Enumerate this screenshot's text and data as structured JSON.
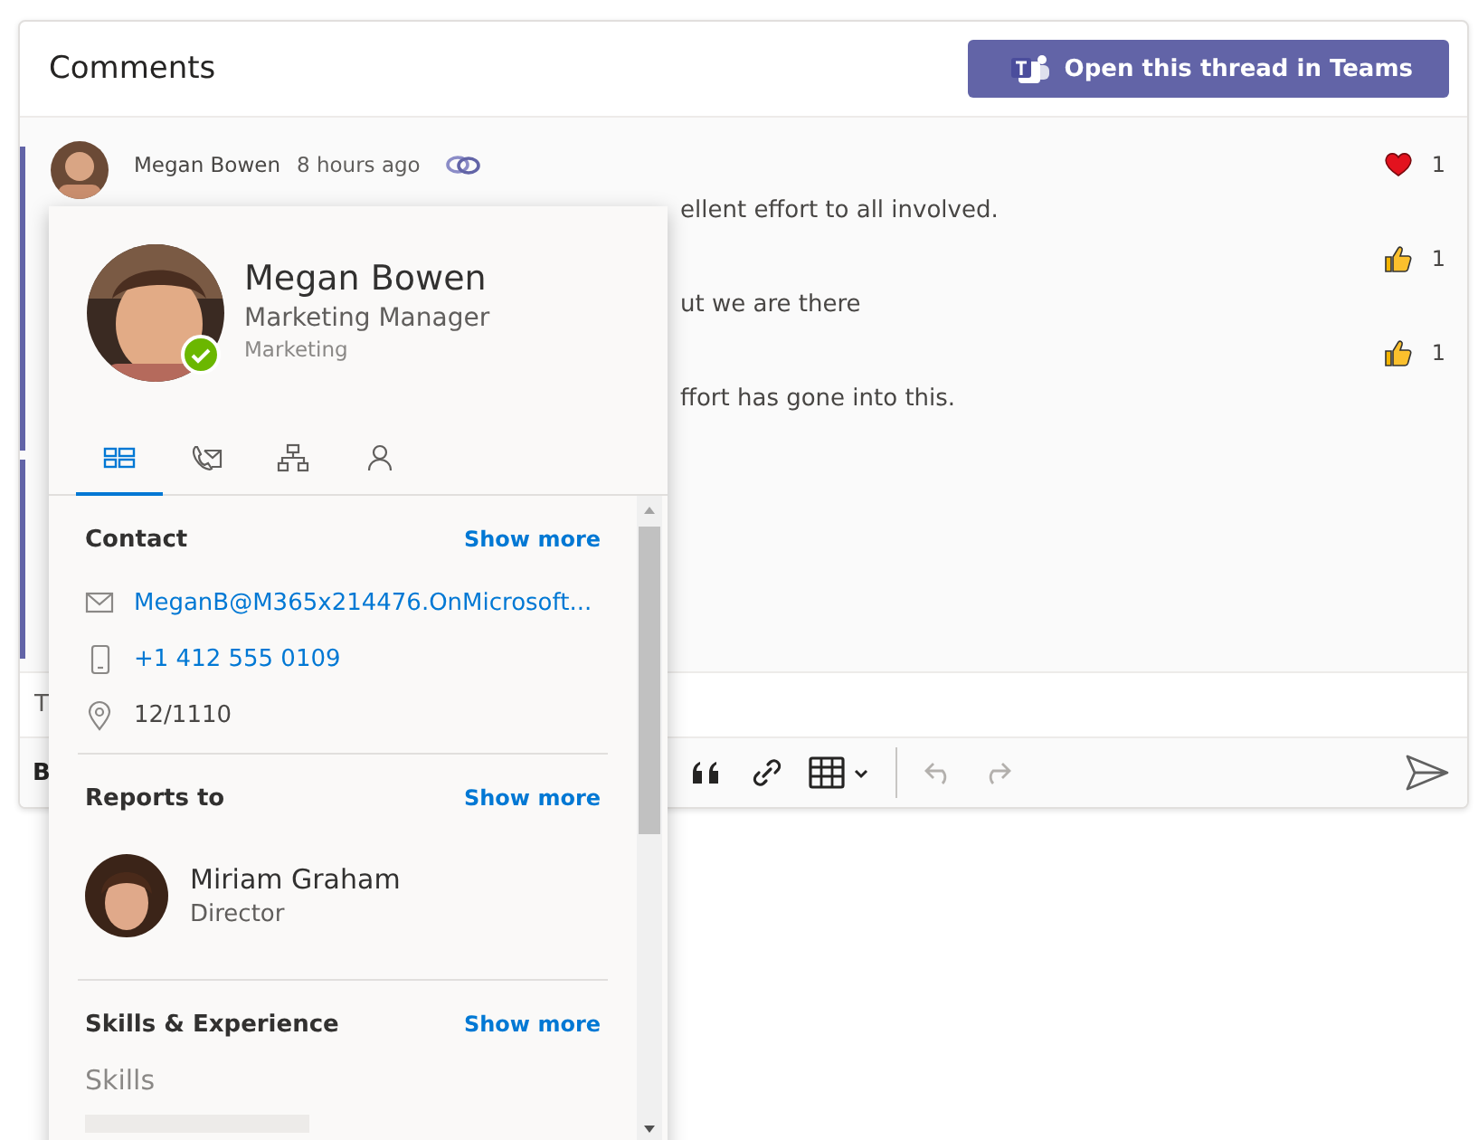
{
  "header": {
    "title": "Comments",
    "teams_button": "Open this thread in Teams"
  },
  "comment": {
    "author": "Megan Bowen",
    "time": "8 hours ago"
  },
  "messages": [
    {
      "text": "ellent effort to all involved.",
      "reaction": {
        "kind": "heart",
        "count": "1"
      }
    },
    {
      "text": "ut we are there",
      "reaction": {
        "kind": "thumbs",
        "count": "1"
      }
    },
    {
      "text": "ffort has gone into this.",
      "reaction": {
        "kind": "thumbs",
        "count": "1"
      }
    }
  ],
  "composer": {
    "placeholder": "T"
  },
  "toolbar": [
    {
      "kind": "bold",
      "label": "B",
      "disabled": false
    },
    {
      "kind": "quote",
      "disabled": false
    },
    {
      "kind": "link",
      "disabled": false
    },
    {
      "kind": "table",
      "disabled": false
    },
    {
      "kind": "undo",
      "disabled": true
    },
    {
      "kind": "redo",
      "disabled": true
    },
    {
      "kind": "send",
      "disabled": false
    }
  ],
  "profile_card": {
    "name": "Megan Bowen",
    "job_title": "Marketing Manager",
    "department": "Marketing",
    "online": true,
    "tabs": [
      {
        "kind": "overview",
        "selected": true
      },
      {
        "kind": "contact",
        "selected": false
      },
      {
        "kind": "organization",
        "selected": false
      },
      {
        "kind": "person",
        "selected": false
      }
    ],
    "sections": [
      {
        "kind": "contact",
        "title": "Contact",
        "show_more": "Show more",
        "items": [
          {
            "kind": "email",
            "text": "MeganB@M365x214476.OnMicrosoft..."
          },
          {
            "kind": "phone",
            "text": "+1 412 555 0109"
          },
          {
            "kind": "location",
            "text": "12/1110"
          }
        ]
      },
      {
        "kind": "reports",
        "title": "Reports to",
        "show_more": "Show more",
        "person": {
          "name": "Miriam Graham",
          "title": "Director"
        }
      },
      {
        "kind": "skills",
        "title": "Skills & Experience",
        "show_more": "Show more",
        "subheading": "Skills"
      }
    ]
  }
}
